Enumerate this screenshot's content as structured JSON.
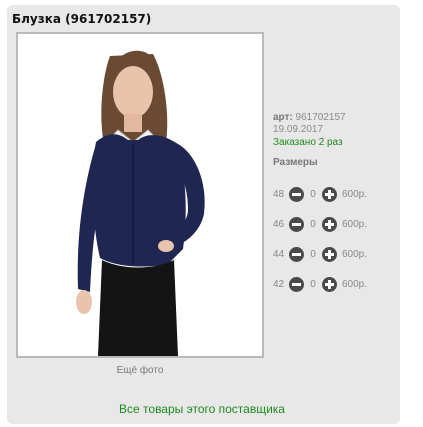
{
  "product": {
    "title": "Блузка (961702157)",
    "art_label": "арт:",
    "art_value": "961702157",
    "date": "19.09.2017",
    "ordered": "Заказано 2 раз",
    "sizes_heading": "Размеры",
    "sizes": [
      {
        "size": "48",
        "qty": "0",
        "price": "600р."
      },
      {
        "size": "46",
        "qty": "0",
        "price": "600р."
      },
      {
        "size": "44",
        "qty": "0",
        "price": "600р."
      },
      {
        "size": "42",
        "qty": "0",
        "price": "600р."
      }
    ]
  },
  "gallery": {
    "more_photos": "Ещё фото"
  },
  "footer": {
    "supplier_link": "Все товары этого поставщика"
  },
  "colors": {
    "accent_green": "#1e8a1e",
    "button_dark": "#4a4a4a",
    "panel_bg": "#e8e8e8"
  },
  "icons": [
    "minus-circle-icon",
    "plus-circle-icon"
  ]
}
